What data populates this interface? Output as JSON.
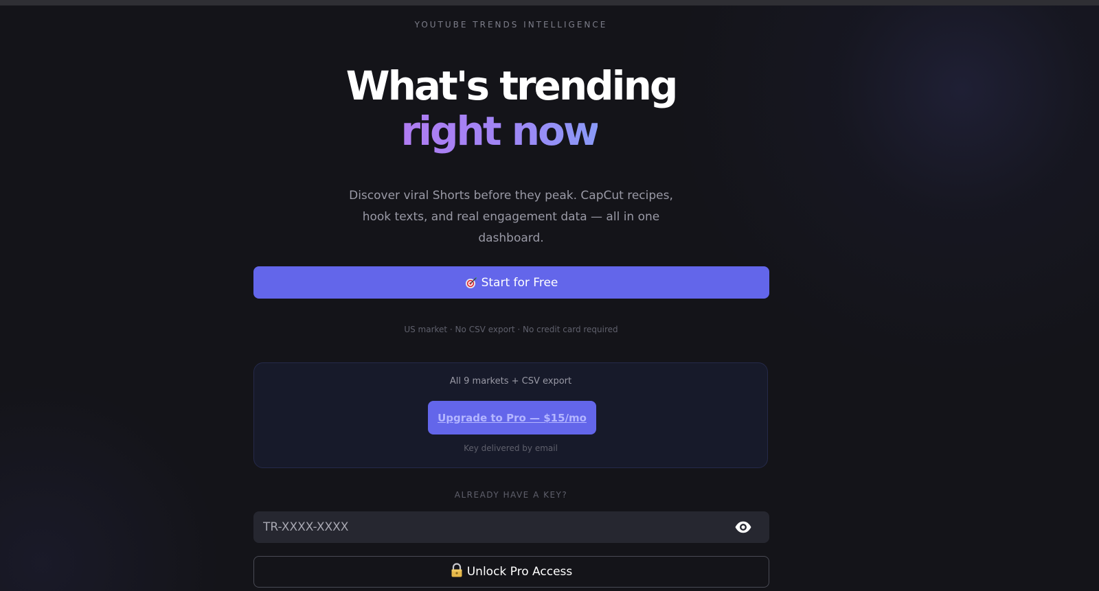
{
  "header": {
    "eyebrow": "YOUTUBE TRENDS INTELLIGENCE"
  },
  "hero": {
    "line1": "What's trending",
    "line2": "right now"
  },
  "subtitle": "Discover viral Shorts before they peak. CapCut recipes, hook texts, and real engagement data — all in one dashboard.",
  "start": {
    "icon": "target-icon",
    "label": "Start for Free",
    "note": "US market · No CSV export · No credit card required"
  },
  "pro_card": {
    "title": "All 9 markets + CSV export",
    "upgrade_label": "Upgrade to Pro — $15/mo",
    "note": "Key delivered by email"
  },
  "key": {
    "label": "ALREADY HAVE A KEY?",
    "placeholder": "TR-XXXX-XXXX",
    "value": "",
    "toggle_icon": "eye-icon"
  },
  "unlock": {
    "icon": "lock-icon",
    "label": "Unlock Pro Access"
  },
  "colors": {
    "background": "#141419",
    "accent": "#6366ea",
    "gradient_start": "#b07cf2",
    "gradient_end": "#8a9af7"
  }
}
